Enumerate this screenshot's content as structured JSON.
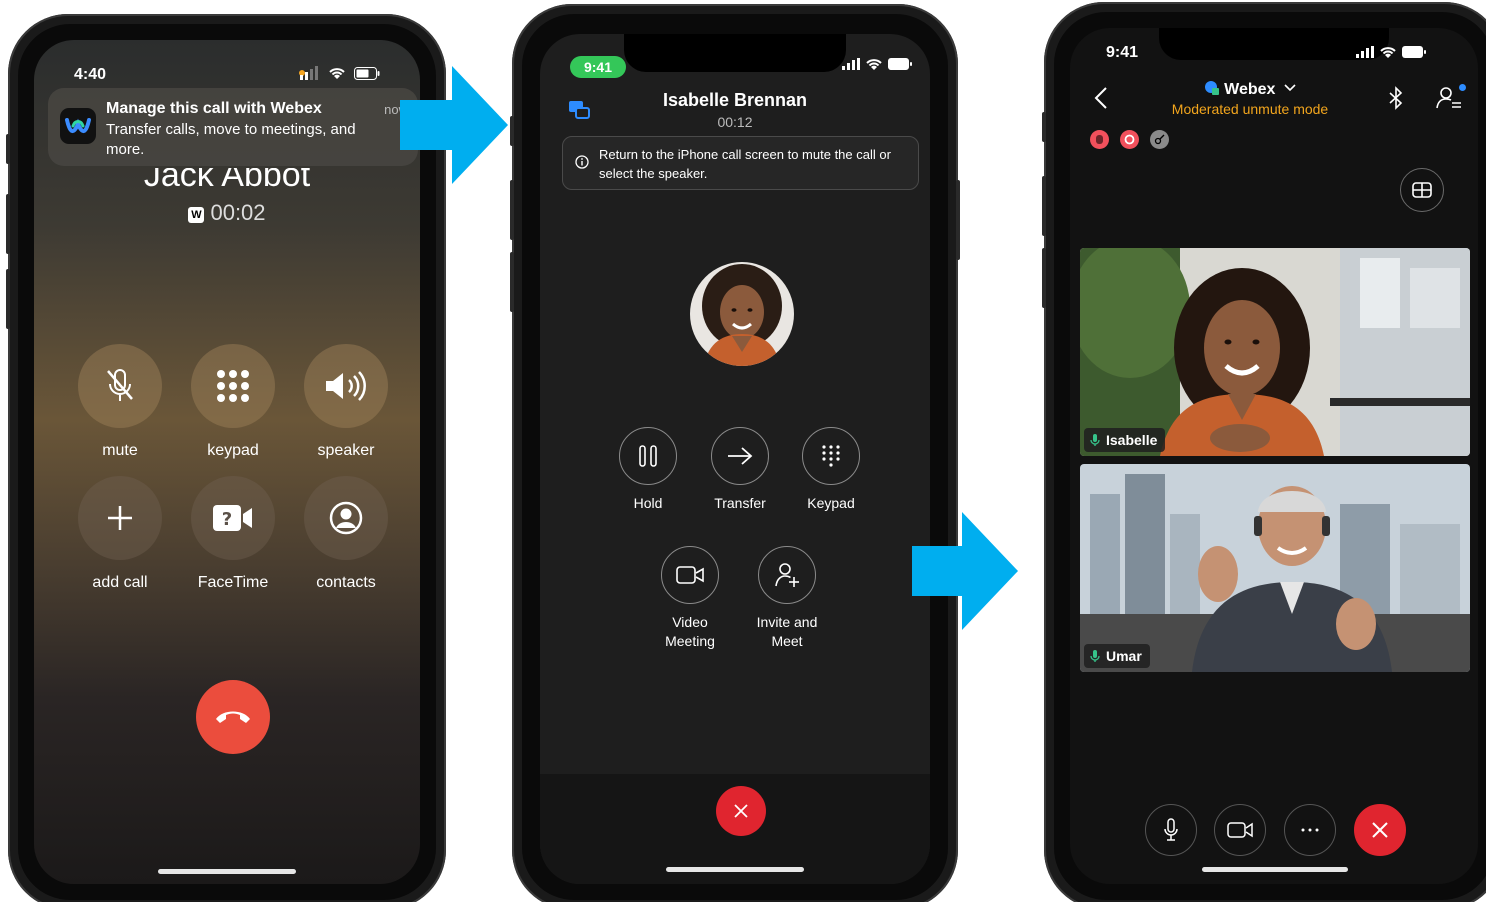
{
  "phone1": {
    "status": {
      "time": "4:40"
    },
    "notification": {
      "title": "Manage this call with Webex",
      "body": "Transfer calls, move to meetings, and more.",
      "time": "now"
    },
    "caller_name": "Jack Abbot",
    "timer": "00:02",
    "timer_badge": "W",
    "buttons": [
      {
        "label": "mute",
        "icon": "mic-off-icon"
      },
      {
        "label": "keypad",
        "icon": "keypad-icon"
      },
      {
        "label": "speaker",
        "icon": "speaker-icon"
      },
      {
        "label": "add call",
        "icon": "plus-icon"
      },
      {
        "label": "FaceTime",
        "icon": "facetime-icon"
      },
      {
        "label": "contacts",
        "icon": "contacts-icon"
      }
    ],
    "end_call_color": "#eb4d3d"
  },
  "phone2": {
    "status": {
      "time": "9:41"
    },
    "caller_name": "Isabelle Brennan",
    "duration": "00:12",
    "info": "Return to the iPhone call screen to mute the call or select the speaker.",
    "buttons": [
      {
        "label": "Hold",
        "icon": "pause-icon"
      },
      {
        "label": "Transfer",
        "icon": "arrow-right-icon"
      },
      {
        "label": "Keypad",
        "icon": "keypad-icon"
      },
      {
        "label": "Video Meeting",
        "icon": "video-icon"
      },
      {
        "label": "Invite and Meet",
        "icon": "add-person-icon"
      }
    ],
    "accent": "#34c759",
    "end_call_color": "#e0252f"
  },
  "phone3": {
    "status": {
      "time": "9:41"
    },
    "title": "Webex",
    "subtitle": "Moderated unmute mode",
    "subtitle_color": "#f2a51d",
    "participants": [
      {
        "name": "Isabelle"
      },
      {
        "name": "Umar"
      }
    ],
    "end_call_color": "#e0252f"
  },
  "arrow_color": "#00aeef"
}
